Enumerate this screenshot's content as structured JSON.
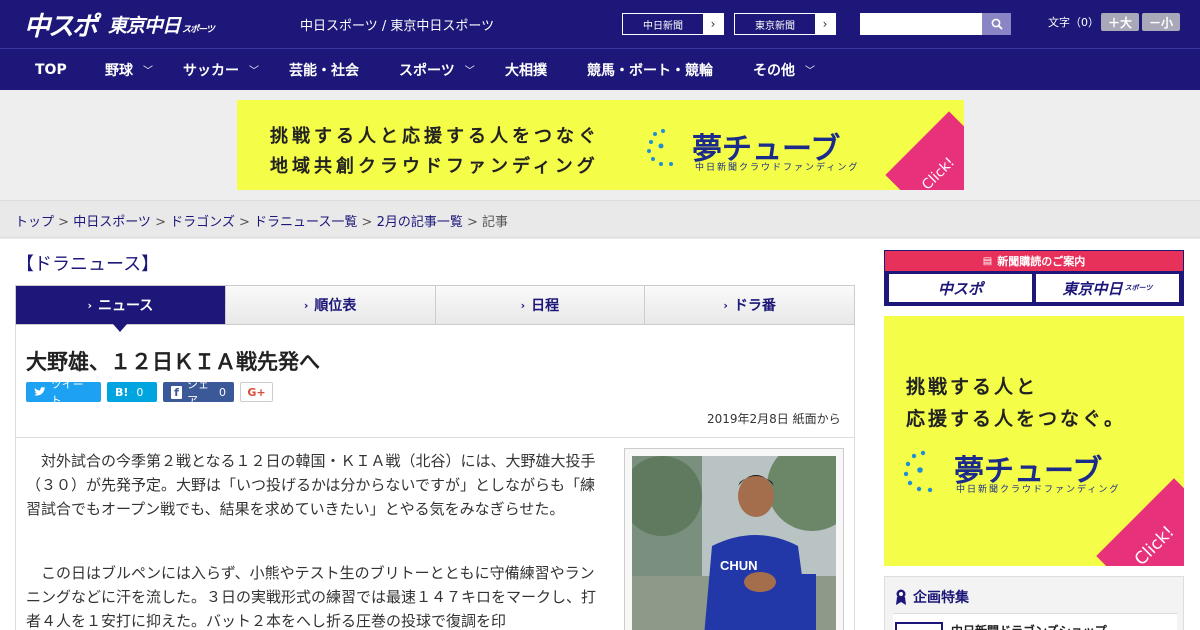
{
  "header": {
    "logo_chunichi_sports": "中スポ",
    "logo_tokyo_chunichi": "東京中日",
    "logo_tokyo_suffix": "スポーツ",
    "tagline": "中日スポーツ / 東京中日スポーツ",
    "links": [
      {
        "label": "中日新聞"
      },
      {
        "label": "東京新聞"
      }
    ],
    "search_placeholder": "",
    "font_size_label": "文字（0）",
    "font_bigger": "＋大",
    "font_smaller": "－小"
  },
  "nav": {
    "items": [
      {
        "label": "TOP",
        "has_menu": false
      },
      {
        "label": "野球",
        "has_menu": true
      },
      {
        "label": "サッカー",
        "has_menu": true
      },
      {
        "label": "芸能・社会",
        "has_menu": false
      },
      {
        "label": "スポーツ",
        "has_menu": true
      },
      {
        "label": "大相撲",
        "has_menu": false
      },
      {
        "label": "競馬・ボート・競輪",
        "has_menu": false
      },
      {
        "label": "その他",
        "has_menu": true
      }
    ]
  },
  "banner": {
    "line1": "挑戦する人と応援する人をつなぐ",
    "line2": "地域共創クラウドファンディング",
    "brand": "夢チューブ",
    "sub": "中日新聞クラウドファンディング",
    "click": "Click!"
  },
  "breadcrumb": {
    "items": [
      "トップ",
      "中日スポーツ",
      "ドラゴンズ",
      "ドラニュース一覧",
      "2月の記事一覧"
    ],
    "current": "記事",
    "sep": " > "
  },
  "section_title": "【ドラニュース】",
  "tabs": [
    {
      "label": "ニュース",
      "active": true
    },
    {
      "label": "順位表",
      "active": false
    },
    {
      "label": "日程",
      "active": false
    },
    {
      "label": "ドラ番",
      "active": false
    }
  ],
  "article": {
    "headline": "大野雄、１２日ＫＩＡ戦先発へ",
    "share": {
      "tweet": "ツイート",
      "hatena_count": "0",
      "fb_label": "シェア",
      "fb_count": "0",
      "gplus": "G+"
    },
    "dateline": "2019年2月8日 紙面から",
    "paragraphs": [
      "対外試合の今季第２戦となる１２日の韓国・ＫＩＡ戦（北谷）には、大野雄大投手（３０）が先発予定。大野は「いつ投げるかは分からないですが」としながらも「練習試合でもオープン戦でも、結果を求めていきたい」とやる気をみなぎらせた。",
      "この日はブルペンには入らず、小熊やテスト生のブリトーとともに守備練習やランニングなどに汗を流した。３日の実戦形式の練習では最速１４７キロをマークし、打者４人を１安打に抑えた。バット２本をへし折る圧巻の投球で復調を印"
    ]
  },
  "sidebar": {
    "subscription_head": "新聞購読のご案内",
    "logo1": "中スポ",
    "logo2": "東京中日",
    "logo2_suffix": "スポーツ",
    "ad": {
      "line1": "挑戦する人と",
      "line2": "応援する人をつなぐ。",
      "brand": "夢チューブ",
      "sub": "中日新聞クラウドファンディング",
      "click": "Click!"
    },
    "feature_title": "企画特集",
    "feature_item": "中日新聞ドラゴンズショップ"
  },
  "colors": {
    "brand_navy": "#1c1778",
    "ad_yellow": "#f4fd47",
    "ad_pink": "#e8317b",
    "twitter": "#1da1f2",
    "hatena": "#00a4de",
    "facebook": "#3b5998"
  }
}
